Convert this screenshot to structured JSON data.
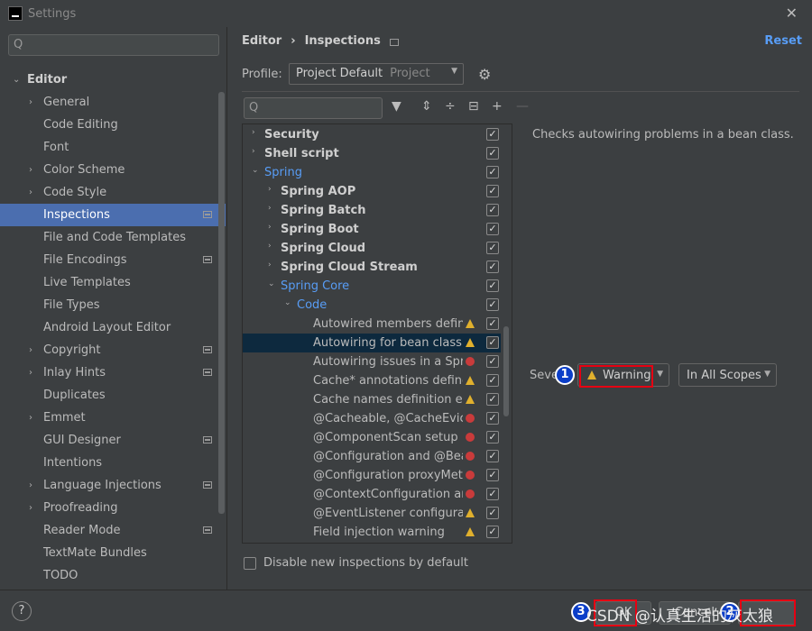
{
  "window": {
    "title": "Settings",
    "close": "✕"
  },
  "sidebar": {
    "search_glyph": "Q",
    "items": [
      {
        "label": "Editor",
        "arrow": "⌄",
        "level": 0,
        "bold": true
      },
      {
        "label": "General",
        "arrow": "›",
        "level": 1
      },
      {
        "label": "Code Editing",
        "level": 1
      },
      {
        "label": "Font",
        "level": 1
      },
      {
        "label": "Color Scheme",
        "arrow": "›",
        "level": 1
      },
      {
        "label": "Code Style",
        "arrow": "›",
        "level": 1
      },
      {
        "label": "Inspections",
        "level": 1,
        "selected": true,
        "badge": true
      },
      {
        "label": "File and Code Templates",
        "level": 1
      },
      {
        "label": "File Encodings",
        "level": 1,
        "badge": true
      },
      {
        "label": "Live Templates",
        "level": 1
      },
      {
        "label": "File Types",
        "level": 1
      },
      {
        "label": "Android Layout Editor",
        "level": 1
      },
      {
        "label": "Copyright",
        "arrow": "›",
        "level": 1,
        "badge": true
      },
      {
        "label": "Inlay Hints",
        "arrow": "›",
        "level": 1,
        "badge": true
      },
      {
        "label": "Duplicates",
        "level": 1
      },
      {
        "label": "Emmet",
        "arrow": "›",
        "level": 1
      },
      {
        "label": "GUI Designer",
        "level": 1,
        "badge": true
      },
      {
        "label": "Intentions",
        "level": 1
      },
      {
        "label": "Language Injections",
        "arrow": "›",
        "level": 1,
        "badge": true
      },
      {
        "label": "Proofreading",
        "arrow": "›",
        "level": 1
      },
      {
        "label": "Reader Mode",
        "level": 1,
        "badge": true
      },
      {
        "label": "TextMate Bundles",
        "level": 1
      },
      {
        "label": "TODO",
        "level": 1
      }
    ]
  },
  "header": {
    "crumb1": "Editor",
    "sep": "›",
    "crumb2": "Inspections",
    "reset": "Reset"
  },
  "profile": {
    "label": "Profile:",
    "value": "Project Default",
    "scope": "Project"
  },
  "inspections": [
    {
      "label": "Security",
      "level": 0,
      "arrow": "›",
      "style": "b"
    },
    {
      "label": "Shell script",
      "level": 0,
      "arrow": "›",
      "style": "b"
    },
    {
      "label": "Spring",
      "level": 0,
      "arrow": "⌄",
      "style": "blue"
    },
    {
      "label": "Spring AOP",
      "level": 1,
      "arrow": "›",
      "style": "b"
    },
    {
      "label": "Spring Batch",
      "level": 1,
      "arrow": "›",
      "style": "b"
    },
    {
      "label": "Spring Boot",
      "level": 1,
      "arrow": "›",
      "style": "b"
    },
    {
      "label": "Spring Cloud",
      "level": 1,
      "arrow": "›",
      "style": "b"
    },
    {
      "label": "Spring Cloud Stream",
      "level": 1,
      "arrow": "›",
      "style": "b"
    },
    {
      "label": "Spring Core",
      "level": 1,
      "arrow": "⌄",
      "style": "blue"
    },
    {
      "label": "Code",
      "level": 2,
      "arrow": "⌄",
      "style": "blue"
    },
    {
      "label": "Autowired members defined",
      "level": 3,
      "sev": "warn"
    },
    {
      "label": "Autowiring for bean class",
      "level": 3,
      "sev": "warn",
      "selected": true
    },
    {
      "label": "Autowiring issues in a Spring",
      "level": 3,
      "sev": "err"
    },
    {
      "label": "Cache* annotations defined",
      "level": 3,
      "sev": "warn"
    },
    {
      "label": "Cache names definition erro",
      "level": 3,
      "sev": "warn"
    },
    {
      "label": "@Cacheable, @CacheEvict, @",
      "level": 3,
      "sev": "err"
    },
    {
      "label": "@ComponentScan setup",
      "level": 3,
      "sev": "err"
    },
    {
      "label": "@Configuration and @Bean",
      "level": 3,
      "sev": "err"
    },
    {
      "label": "@Configuration proxyMetho",
      "level": 3,
      "sev": "err"
    },
    {
      "label": "@ContextConfiguration and",
      "level": 3,
      "sev": "err"
    },
    {
      "label": "@EventListener configuratio",
      "level": 3,
      "sev": "warn"
    },
    {
      "label": "Field injection warning",
      "level": 3,
      "sev": "warn"
    }
  ],
  "detail": {
    "description": "Checks autowiring problems in a bean class.",
    "severity_label": "Seve",
    "severity_value": "Warning",
    "scope_value": "In All Scopes"
  },
  "annotations": {
    "n1": "1",
    "n2": "2",
    "n3": "3"
  },
  "options": {
    "disable_new": "Disable new inspections by default"
  },
  "footer": {
    "help": "?",
    "ok": "OK",
    "cancel": "Cancel",
    "watermark": "CSDN @认真生活的灰太狼"
  },
  "colors": {
    "accent": "#589df6",
    "selection": "#4b6eaf",
    "warning": "#e0b02d",
    "error": "#c93b3b",
    "annotation_red": "#e60012",
    "badge_blue": "#0b3ec8"
  }
}
